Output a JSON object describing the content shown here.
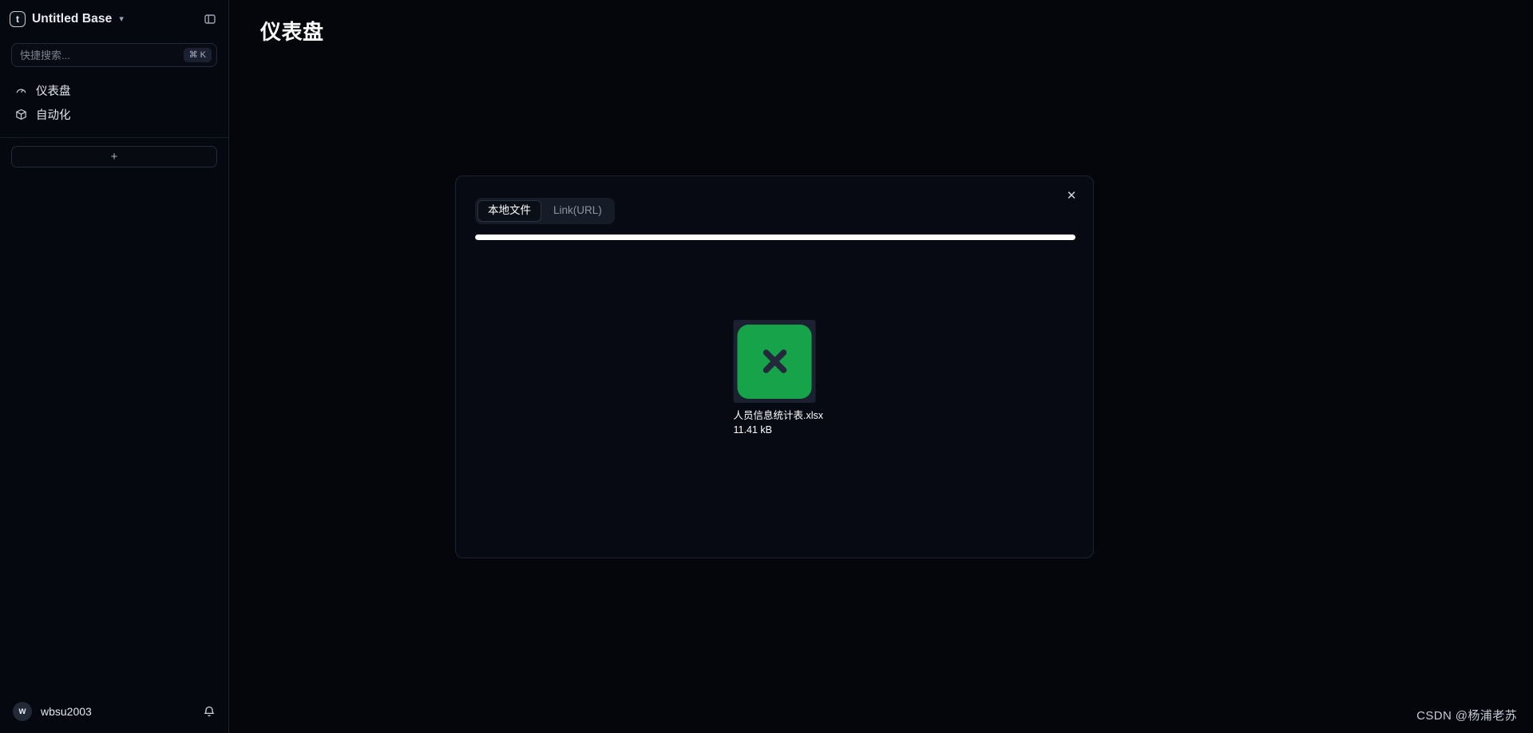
{
  "sidebar": {
    "logo_glyph": "t",
    "base_name": "Untitled Base",
    "chevron": "▾",
    "panel_toggle_icon": "panel-left-icon",
    "search": {
      "placeholder": "快捷搜索...",
      "value": "",
      "shortcut_modifier": "⌘",
      "shortcut_key": "K"
    },
    "items": [
      {
        "label": "仪表盘",
        "icon": "gauge-icon"
      },
      {
        "label": "自动化",
        "icon": "package-icon"
      }
    ],
    "add_label": "+",
    "user": {
      "avatar_initial": "w",
      "name": "wbsu2003",
      "notification_icon": "bell-icon"
    }
  },
  "main": {
    "page_title": "仪表盘"
  },
  "dialog": {
    "close_label": "✕",
    "tabs": [
      {
        "label": "本地文件",
        "active": true
      },
      {
        "label": "Link(URL)",
        "active": false
      }
    ],
    "progress_percent": 100,
    "file": {
      "icon": "xlsx-file-icon",
      "icon_color": "#16a34a",
      "name": "人员信息统计表.xlsx",
      "size": "11.41 kB"
    }
  },
  "watermark": {
    "text": "CSDN @杨浦老苏"
  },
  "colors": {
    "app_background": "#05070d",
    "sidebar_background": "#060810",
    "accent_green": "#16a34a",
    "progress_fill": "#ffffff",
    "border": "#1d2431"
  }
}
